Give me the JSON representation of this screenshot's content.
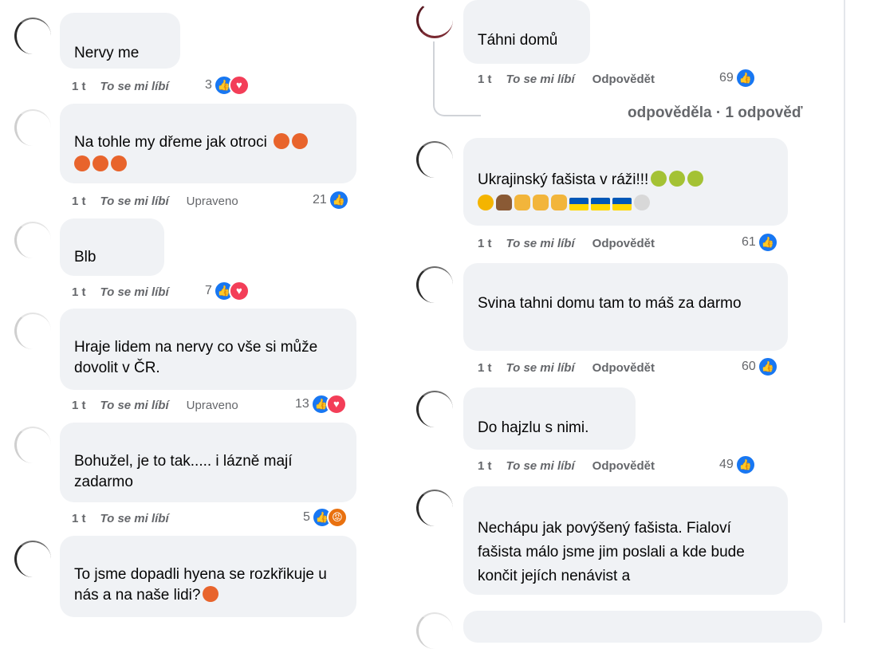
{
  "left_comments": [
    {
      "text": "Nervy me",
      "time": "1 t",
      "like_label": "To se mi líbí",
      "extra": "",
      "count": "3",
      "reactions": [
        "like",
        "heart"
      ]
    },
    {
      "text": "Na tohle my dřeme jak otroci",
      "time": "1 t",
      "like_label": "To se mi líbí",
      "extra": "Upraveno",
      "count": "21",
      "reactions": [
        "like"
      ]
    },
    {
      "text": "Blb",
      "time": "1 t",
      "like_label": "To se mi líbí",
      "extra": "",
      "count": "7",
      "reactions": [
        "like",
        "heart"
      ]
    },
    {
      "text": "Hraje lidem na nervy co vše si může dovolit v ČR.",
      "time": "1 t",
      "like_label": "To se mi líbí",
      "extra": "Upraveno",
      "count": "13",
      "reactions": [
        "like",
        "heart"
      ]
    },
    {
      "text": "Bohužel, je to tak..... i lázně mají zadarmo",
      "time": "1 t",
      "like_label": "To se mi líbí",
      "extra": "",
      "count": "5",
      "reactions": [
        "like",
        "angry"
      ]
    },
    {
      "text": "To jsme dopadli hyena se rozkřikuje u nás a na naše lidi?"
    }
  ],
  "right_comments": [
    {
      "text": "Táhni domů",
      "time": "1 t",
      "like_label": "To se mi líbí",
      "reply_label": "Odpovědět",
      "count": "69"
    },
    {
      "more_replies": "odpověděla · 1 odpověď"
    },
    {
      "text": "Ukrajinský fašista v ráži!!!",
      "time": "1 t",
      "like_label": "To se mi líbí",
      "reply_label": "Odpovědět",
      "count": "61"
    },
    {
      "text": "Svina tahni domu tam to máš za darmo",
      "time": "1 t",
      "like_label": "To se mi líbí",
      "reply_label": "Odpovědět",
      "count": "60"
    },
    {
      "text": "Do hajzlu s nimi.",
      "time": "1 t",
      "like_label": "To se mi líbí",
      "reply_label": "Odpovědět",
      "count": "49"
    },
    {
      "text": "Nechápu jak povýšený fašista. Fialoví fašista málo jsme jim poslali a kde bude končit jejích nenávist a"
    }
  ],
  "icons": {
    "like": "like-icon",
    "heart": "heart-icon",
    "angry": "angry-icon"
  },
  "colors": {
    "like": "#1877f2",
    "heart": "#f33e58",
    "angry": "#e9710f",
    "bubble": "#f0f2f5",
    "meta": "#65676b"
  }
}
